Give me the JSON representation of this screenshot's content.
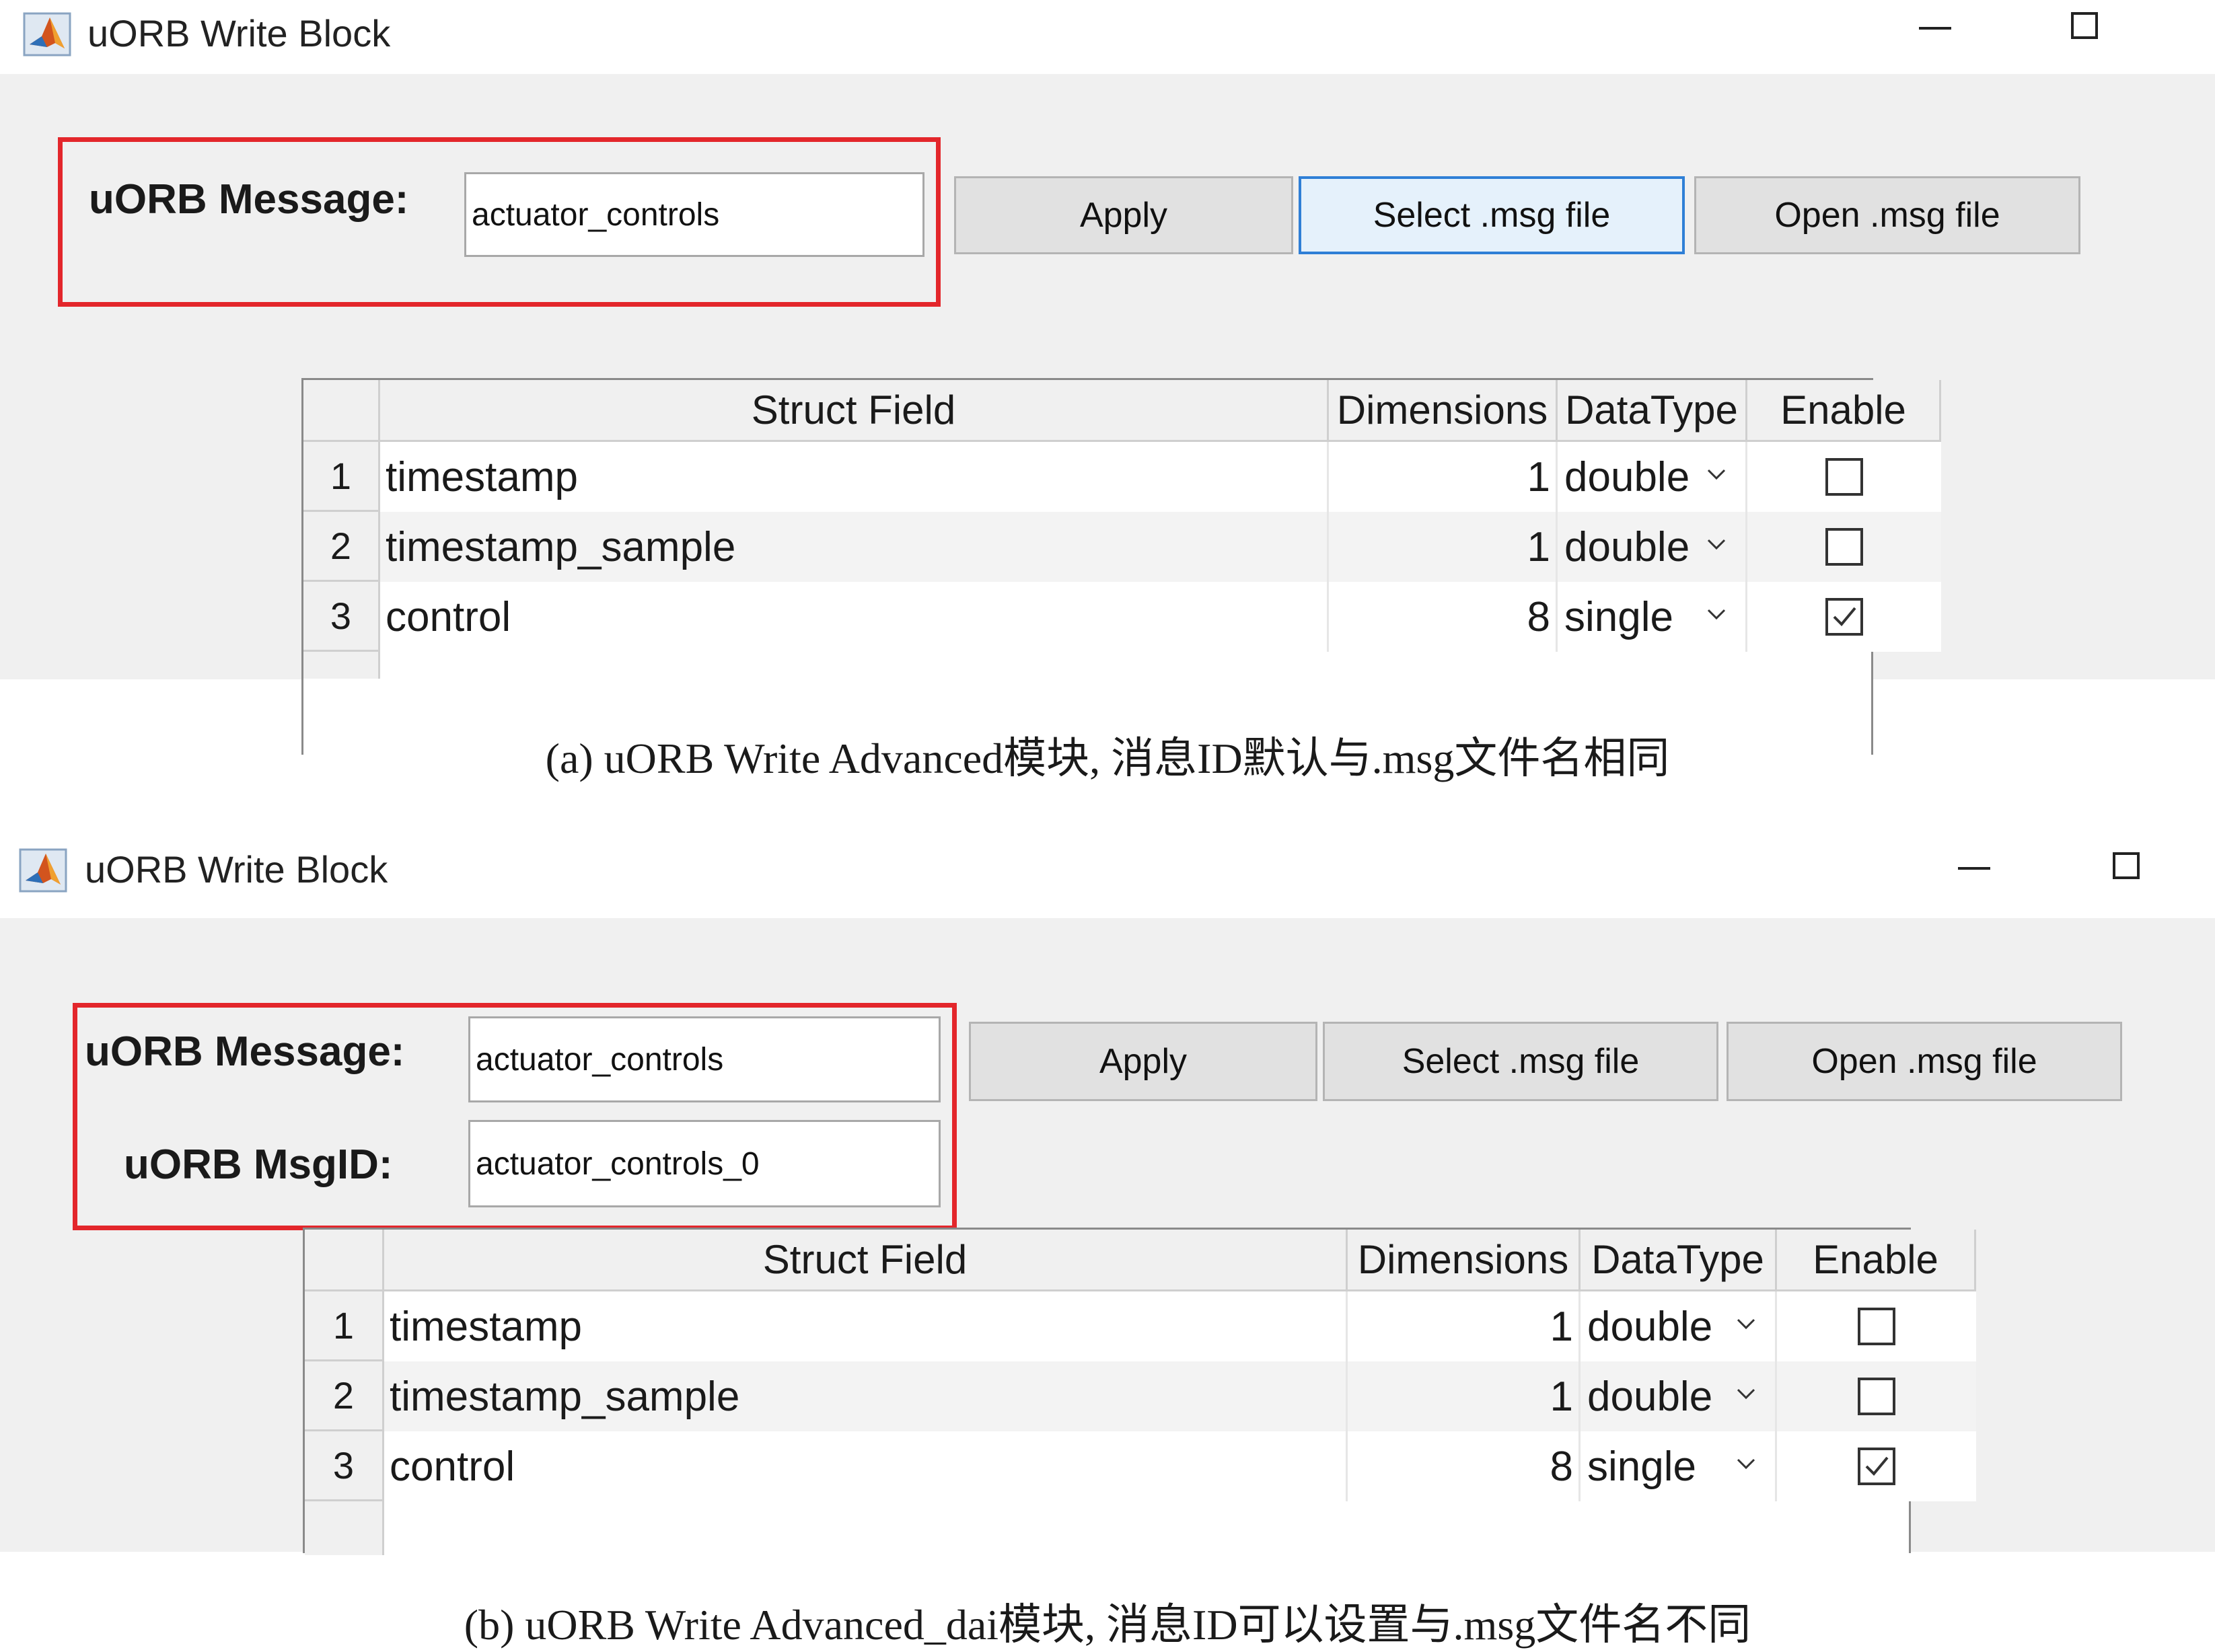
{
  "panel_a": {
    "window_title": "uORB Write Block",
    "message_label": "uORB Message:",
    "message_value": "actuator_controls",
    "buttons": {
      "apply": "Apply",
      "select": "Select .msg file",
      "open": "Open .msg file"
    },
    "table": {
      "headers": {
        "field": "Struct Field",
        "dimensions": "Dimensions",
        "datatype": "DataType",
        "enable": "Enable"
      },
      "rows": [
        {
          "num": "1",
          "field": "timestamp",
          "dimensions": "1",
          "datatype": "double",
          "enabled": false
        },
        {
          "num": "2",
          "field": "timestamp_sample",
          "dimensions": "1",
          "datatype": "double",
          "enabled": false
        },
        {
          "num": "3",
          "field": "control",
          "dimensions": "8",
          "datatype": "single",
          "enabled": true
        }
      ]
    },
    "caption": "(a) uORB Write Advanced模块, 消息ID默认与.msg文件名相同"
  },
  "panel_b": {
    "window_title": "uORB Write Block",
    "message_label": "uORB Message:",
    "message_value": "actuator_controls",
    "msgid_label": "uORB MsgID:",
    "msgid_value": "actuator_controls_0",
    "buttons": {
      "apply": "Apply",
      "select": "Select .msg file",
      "open": "Open .msg file"
    },
    "table": {
      "headers": {
        "field": "Struct Field",
        "dimensions": "Dimensions",
        "datatype": "DataType",
        "enable": "Enable"
      },
      "rows": [
        {
          "num": "1",
          "field": "timestamp",
          "dimensions": "1",
          "datatype": "double",
          "enabled": false
        },
        {
          "num": "2",
          "field": "timestamp_sample",
          "dimensions": "1",
          "datatype": "double",
          "enabled": false
        },
        {
          "num": "3",
          "field": "control",
          "dimensions": "8",
          "datatype": "single",
          "enabled": true
        }
      ]
    },
    "caption": "(b) uORB Write Advanced_dai模块, 消息ID可以设置与.msg文件名不同"
  },
  "colors": {
    "highlight": "#e3262b",
    "focus_border": "#2f7fd6",
    "content_bg": "#f0f0f0"
  },
  "icons": {
    "app": "matlab-logo-icon",
    "minimize": "minimize-icon",
    "maximize": "maximize-icon",
    "dropdown": "chevron-down-icon",
    "check": "checkmark-icon"
  }
}
